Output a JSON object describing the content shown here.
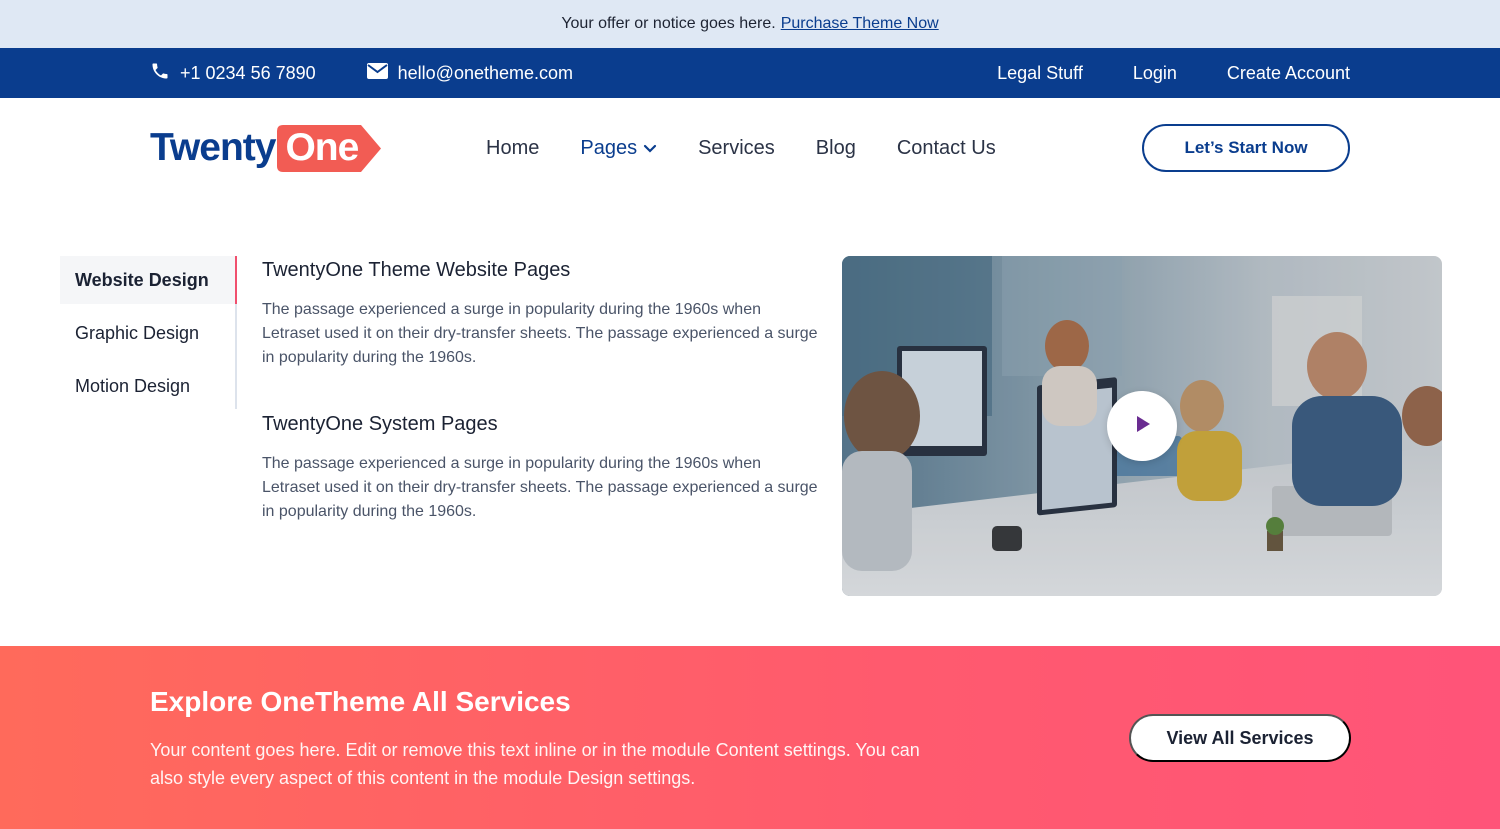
{
  "notice": {
    "text": "Your offer or notice goes here.",
    "link": "Purchase Theme Now"
  },
  "topbar": {
    "phone": "+1 0234 56 7890",
    "email": "hello@onetheme.com",
    "links": [
      "Legal Stuff",
      "Login",
      "Create Account"
    ]
  },
  "header": {
    "logo_part1": "Twenty",
    "logo_part2": "One",
    "nav": [
      "Home",
      "Pages",
      "Services",
      "Blog",
      "Contact Us"
    ],
    "cta": "Let’s Start Now"
  },
  "tabs": [
    "Website Design",
    "Graphic Design",
    "Motion Design"
  ],
  "content": [
    {
      "title": "TwentyOne Theme Website Pages",
      "text": "The passage experienced a surge in popularity during the 1960s when Letraset used it on their dry-transfer sheets. The passage experienced a surge in popularity during the 1960s."
    },
    {
      "title": "TwentyOne System Pages",
      "text": "The passage experienced a surge in popularity during the 1960s when Letraset used it on their dry-transfer sheets. The passage experienced a surge in popularity during the 1960s."
    }
  ],
  "banner": {
    "title": "Explore OneTheme All Services",
    "text": "Your content goes here. Edit or remove this text inline or in the module Content settings. You can also style every aspect of this content in the module Design settings.",
    "button": "View All Services"
  },
  "colors": {
    "brand_blue": "#0a3d8e",
    "accent_coral": "#f25c54",
    "tab_accent": "#f0506e",
    "play_icon": "#6a2c91"
  },
  "icons": {
    "phone": "phone-icon",
    "email": "envelope-icon",
    "dropdown": "chevron-down-icon",
    "play": "play-icon"
  }
}
